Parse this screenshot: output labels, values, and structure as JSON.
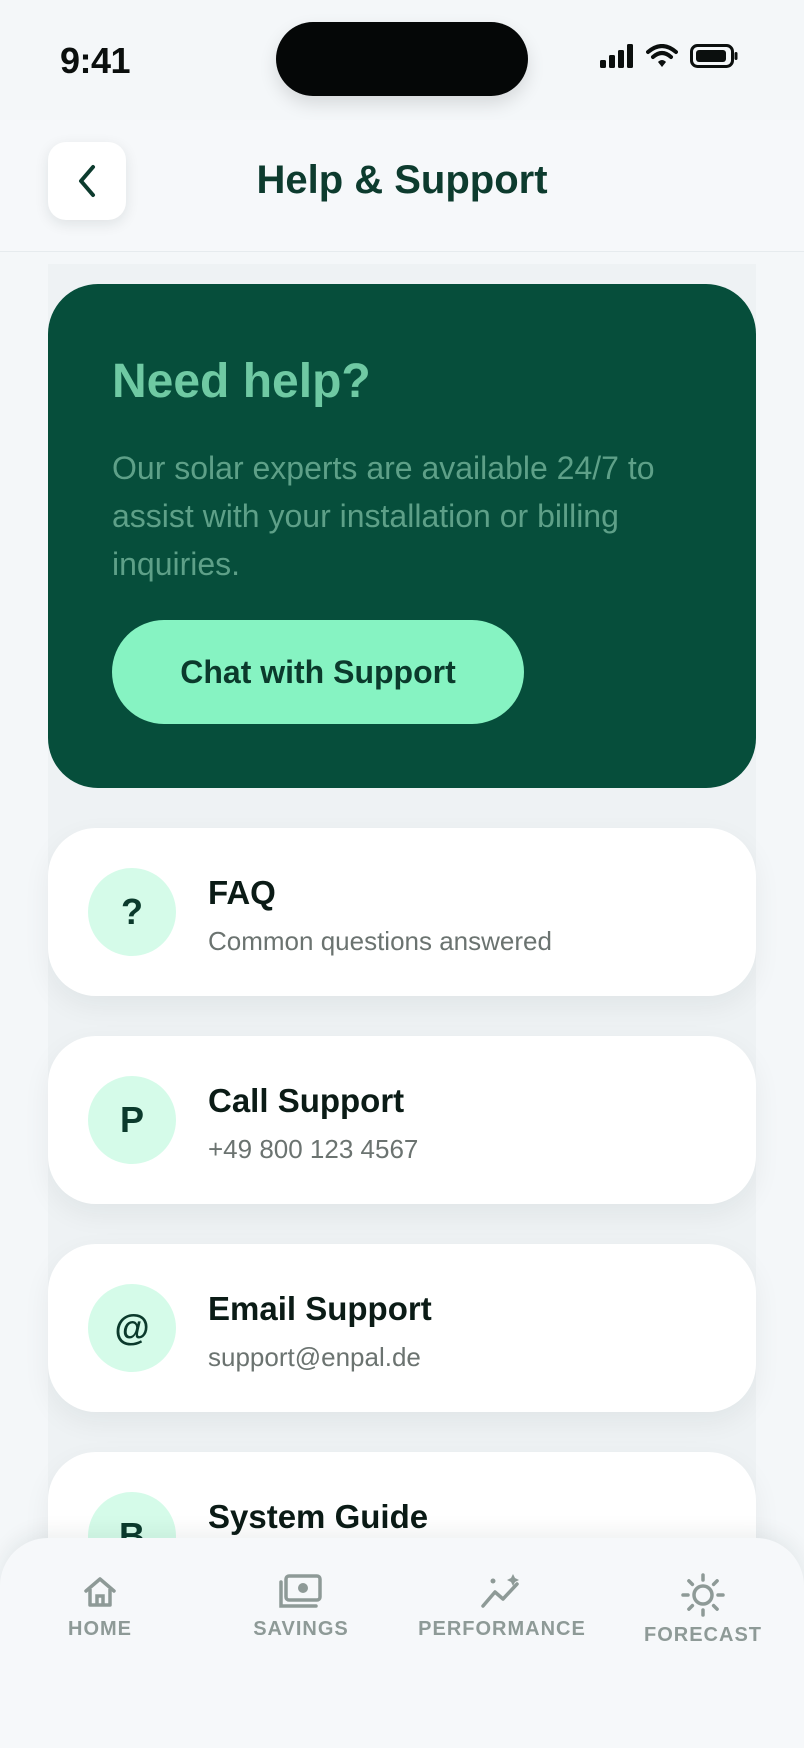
{
  "status_bar": {
    "time": "9:41"
  },
  "header": {
    "title": "Help & Support"
  },
  "hero": {
    "title": "Need help?",
    "text": "Our solar experts are available 24/7 to assist with your installation or billing inquiries.",
    "button_label": "Chat with Support"
  },
  "cards": [
    {
      "icon": "?",
      "title": "FAQ",
      "subtitle": "Common questions answered"
    },
    {
      "icon": "P",
      "title": "Call Support",
      "subtitle": "+49 800 123 4567"
    },
    {
      "icon": "@",
      "title": "Email Support",
      "subtitle": "support@enpal.de"
    },
    {
      "icon": "B",
      "title": "System Guide",
      "subtitle": ""
    }
  ],
  "bottom_nav": [
    {
      "label": "HOME",
      "icon": "home-icon"
    },
    {
      "label": "SAVINGS",
      "icon": "money-icon"
    },
    {
      "label": "PERFORMANCE",
      "icon": "chart-icon"
    },
    {
      "label": "FORECAST",
      "icon": "sun-icon"
    }
  ],
  "colors": {
    "brand_dark": "#064e3b",
    "accent": "#86f3c2",
    "icon_bg": "#d5fbe9",
    "text_dark": "#0d3b2e",
    "muted": "#8e9a97"
  }
}
